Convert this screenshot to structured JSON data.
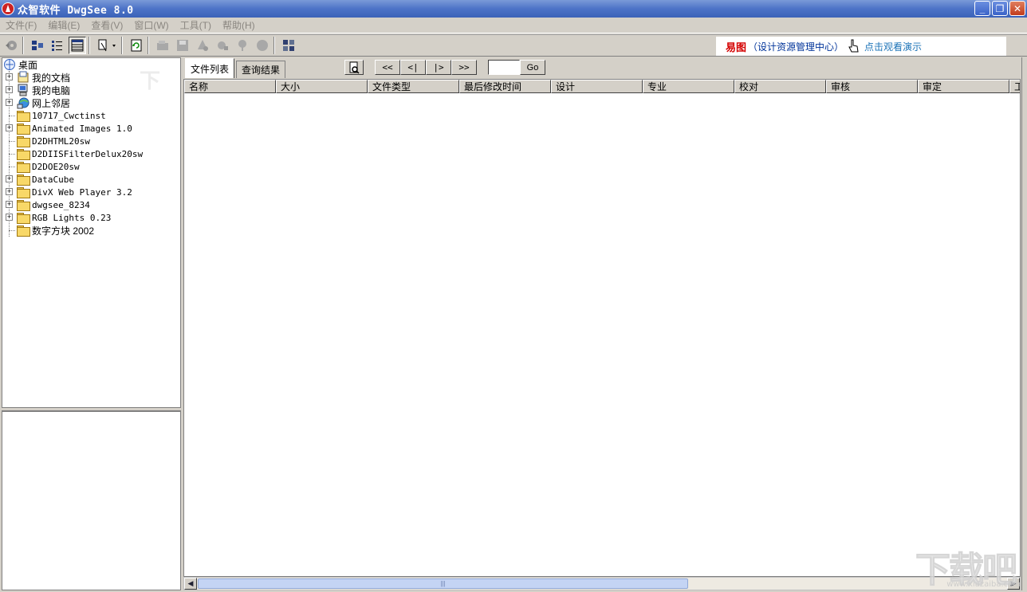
{
  "window": {
    "title": "众智软件 DwgSee 8.0"
  },
  "menu": [
    "文件(F)",
    "编辑(E)",
    "查看(V)",
    "窗口(W)",
    "工具(T)",
    "帮助(H)"
  ],
  "banner": {
    "brand": "易图",
    "subtitle": "（设计资源管理中心）",
    "link": "点击观看演示"
  },
  "tree": {
    "root": "桌面",
    "items": [
      {
        "label": "我的文档",
        "expandable": true,
        "icon": "documents-icon"
      },
      {
        "label": "我的电脑",
        "expandable": true,
        "icon": "computer-icon"
      },
      {
        "label": "网上邻居",
        "expandable": true,
        "icon": "network-icon"
      },
      {
        "label": "10717_Cwctinst",
        "expandable": false,
        "icon": "folder-icon"
      },
      {
        "label": "Animated Images 1.0",
        "expandable": true,
        "icon": "folder-icon"
      },
      {
        "label": "D2DHTML20sw",
        "expandable": false,
        "icon": "folder-icon"
      },
      {
        "label": "D2DIISFilterDelux20sw",
        "expandable": false,
        "icon": "folder-icon"
      },
      {
        "label": "D2DOE20sw",
        "expandable": false,
        "icon": "folder-icon"
      },
      {
        "label": "DataCube",
        "expandable": true,
        "icon": "folder-icon"
      },
      {
        "label": "DivX Web Player 3.2",
        "expandable": true,
        "icon": "folder-icon"
      },
      {
        "label": "dwgsee_8234",
        "expandable": true,
        "icon": "folder-icon"
      },
      {
        "label": "RGB Lights 0.23",
        "expandable": true,
        "icon": "folder-icon"
      },
      {
        "label": "数字方块 2002",
        "expandable": false,
        "icon": "folder-icon"
      }
    ]
  },
  "tabs": [
    "文件列表",
    "查询结果"
  ],
  "nav": {
    "first": "<<",
    "prev": "<|",
    "next": "|>",
    "last": ">>",
    "go": "Go"
  },
  "columns": [
    "名称",
    "大小",
    "文件类型",
    "最后修改时间",
    "设计",
    "专业",
    "校对",
    "审核",
    "审定",
    "工"
  ],
  "watermark": {
    "big": "下载吧",
    "small": "www.xiazaiba.com"
  }
}
